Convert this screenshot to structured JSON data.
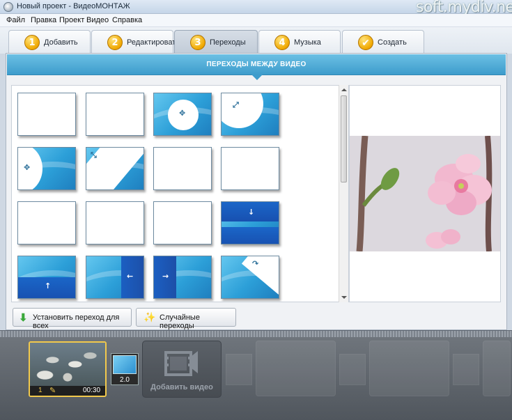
{
  "window": {
    "title": "Новый проект - ВидеоМОНТАЖ",
    "watermark": "soft.mydiv.net"
  },
  "menu": [
    "Файл",
    "Правка",
    "Проект",
    "Видео",
    "Справка"
  ],
  "steps": [
    {
      "num": "1",
      "label": "Добавить"
    },
    {
      "num": "2",
      "label": "Редактировать"
    },
    {
      "num": "3",
      "label": "Переходы",
      "active": true
    },
    {
      "num": "4",
      "label": "Музыка"
    },
    {
      "num": "✔",
      "label": "Создать"
    }
  ],
  "section": {
    "title": "ПЕРЕХОДЫ МЕЖДУ ВИДЕО"
  },
  "buttons": {
    "apply_all": "Установить переход для всех",
    "random": "Случайные переходы"
  },
  "timeline": {
    "clip": {
      "index": "1",
      "duration": "00:30"
    },
    "transition_duration": "2.0",
    "add_video_label": "Добавить видео"
  },
  "colors": {
    "accent_blue": "#3d9ccc",
    "highlight": "#f2c94c",
    "thumb_blue": "#2c9fd8"
  }
}
